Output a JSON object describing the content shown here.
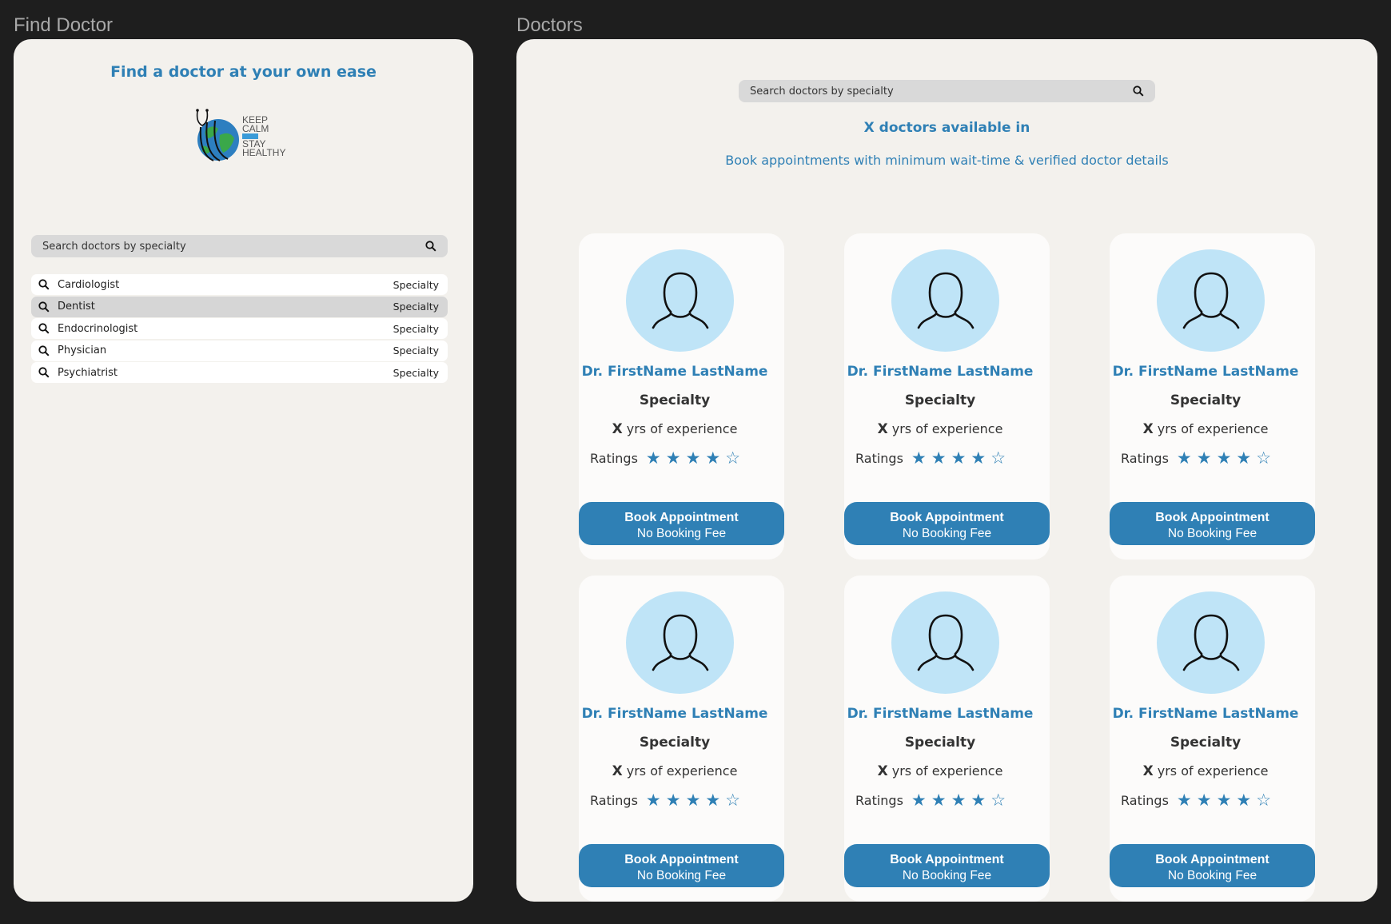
{
  "frames": {
    "left_label": "Find Doctor",
    "right_label": "Doctors"
  },
  "find_doctor": {
    "title": "Find a doctor at your own ease",
    "logo": {
      "icon": "globe-stethoscope-icon",
      "text_line1": "KEEP",
      "text_line2": "CALM",
      "text_line3": "STAY",
      "text_line4": "HEALTHY"
    },
    "search": {
      "placeholder": "Search doctors by specialty"
    },
    "specialties": [
      {
        "name": "Cardiologist",
        "tag": "Specialty",
        "active": false
      },
      {
        "name": "Dentist",
        "tag": "Specialty",
        "active": true
      },
      {
        "name": "Endocrinologist",
        "tag": "Specialty",
        "active": false
      },
      {
        "name": "Physician",
        "tag": "Specialty",
        "active": false
      },
      {
        "name": "Psychiatrist",
        "tag": "Specialty",
        "active": false
      }
    ]
  },
  "doctors": {
    "search": {
      "placeholder": "Search doctors by specialty"
    },
    "count_title": "X doctors available in",
    "subtitle": "Book appointments with minimum wait-time & verified doctor details",
    "cards": [
      {
        "name": "Dr. FirstName LastName",
        "specialty": "Specialty",
        "exp_num": "X",
        "exp_text": " yrs of experience",
        "ratings_label": "Ratings",
        "rating": 4,
        "rating_max": 5,
        "btn_line1": "Book Appointment",
        "btn_line2": "No Booking Fee"
      },
      {
        "name": "Dr. FirstName LastName",
        "specialty": "Specialty",
        "exp_num": "X",
        "exp_text": " yrs of experience",
        "ratings_label": "Ratings",
        "rating": 4,
        "rating_max": 5,
        "btn_line1": "Book Appointment",
        "btn_line2": "No Booking Fee"
      },
      {
        "name": "Dr. FirstName LastName",
        "specialty": "Specialty",
        "exp_num": "X",
        "exp_text": " yrs of experience",
        "ratings_label": "Ratings",
        "rating": 4,
        "rating_max": 5,
        "btn_line1": "Book Appointment",
        "btn_line2": "No Booking Fee"
      },
      {
        "name": "Dr. FirstName LastName",
        "specialty": "Specialty",
        "exp_num": "X",
        "exp_text": " yrs of experience",
        "ratings_label": "Ratings",
        "rating": 4,
        "rating_max": 5,
        "btn_line1": "Book Appointment",
        "btn_line2": "No Booking Fee"
      },
      {
        "name": "Dr. FirstName LastName",
        "specialty": "Specialty",
        "exp_num": "X",
        "exp_text": " yrs of experience",
        "ratings_label": "Ratings",
        "rating": 4,
        "rating_max": 5,
        "btn_line1": "Book Appointment",
        "btn_line2": "No Booking Fee"
      },
      {
        "name": "Dr. FirstName LastName",
        "specialty": "Specialty",
        "exp_num": "X",
        "exp_text": " yrs of experience",
        "ratings_label": "Ratings",
        "rating": 4,
        "rating_max": 5,
        "btn_line1": "Book Appointment",
        "btn_line2": "No Booking Fee"
      }
    ]
  },
  "colors": {
    "accent": "#2f80b5",
    "avatar_bg": "#bfe4f7",
    "panel_bg": "#f3f1ed",
    "background": "#1e1e1e"
  }
}
